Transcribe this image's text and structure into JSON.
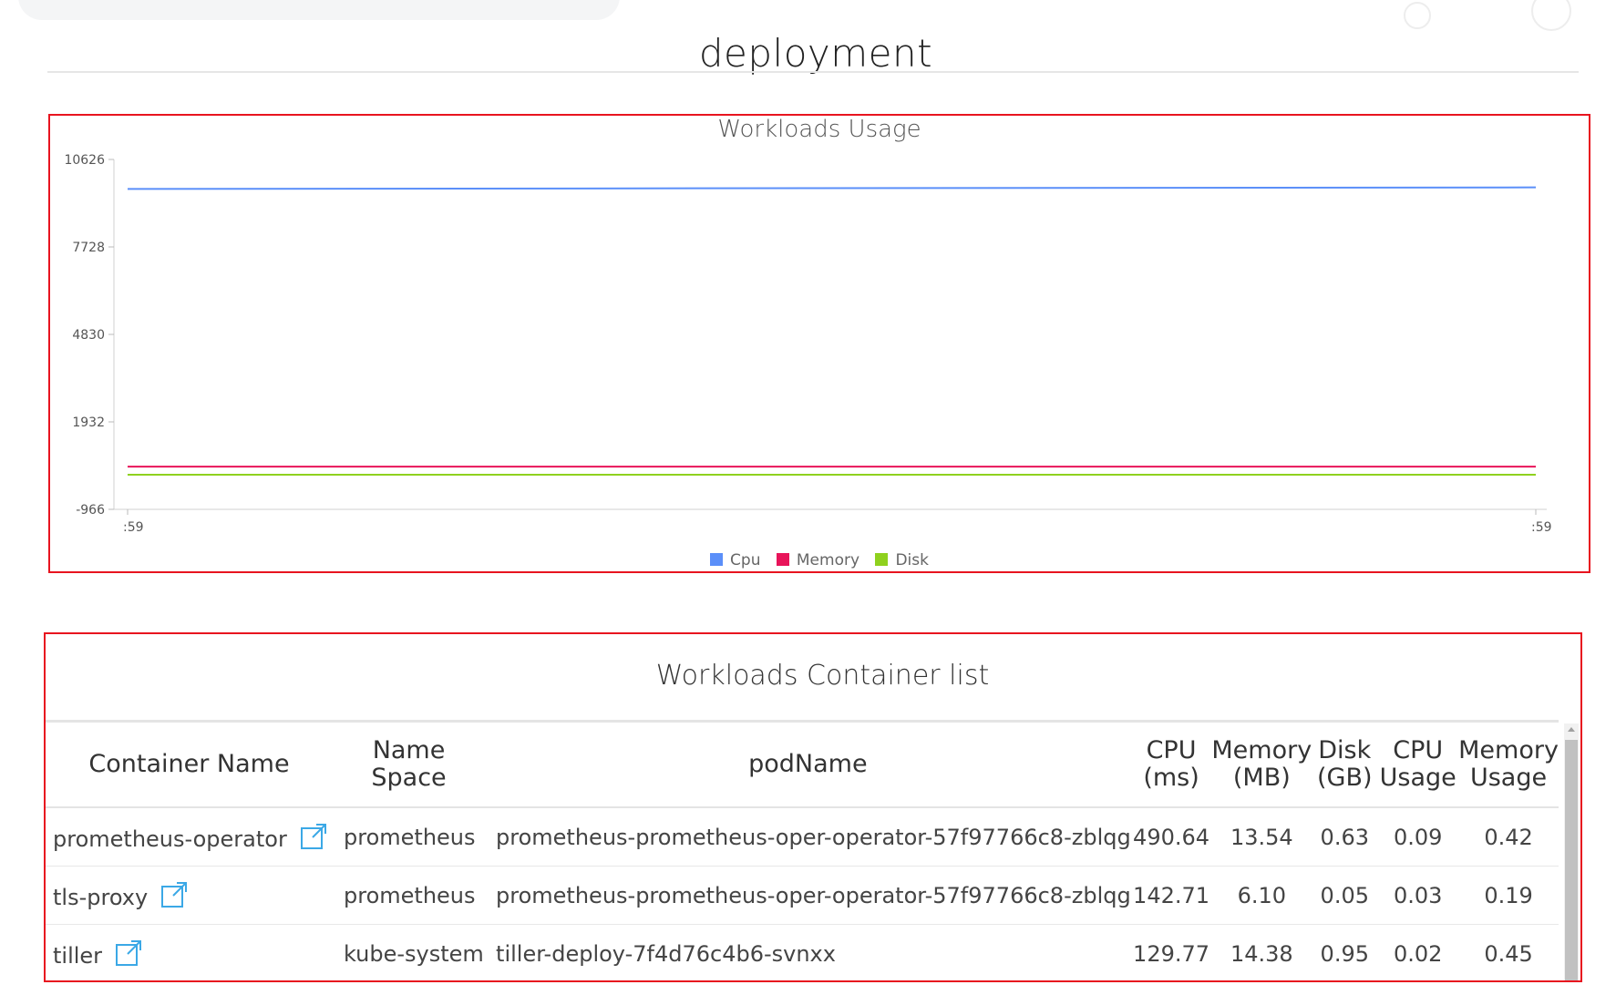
{
  "page": {
    "title": "deployment"
  },
  "chart_panel": {
    "title": "Workloads Usage"
  },
  "chart_data": {
    "type": "line",
    "title": "Workloads Usage",
    "x": [
      ":59",
      ":59"
    ],
    "y_ticks": [
      10626,
      7728,
      4830,
      1932,
      -966
    ],
    "ylim": [
      -966,
      10626
    ],
    "grid": false,
    "legend": "bottom",
    "series": [
      {
        "name": "Cpu",
        "color": "#5b8ff9",
        "values": [
          9649,
          9700
        ]
      },
      {
        "name": "Memory",
        "color": "#e8145a",
        "values": [
          449,
          449
        ]
      },
      {
        "name": "Disk",
        "color": "#8fd11e",
        "values": [
          183,
          183
        ]
      }
    ]
  },
  "table_panel": {
    "title": "Workloads Container list",
    "headers": {
      "name": "Container Name",
      "ns": "Name Space",
      "pod": "podName",
      "cpu_1": "CPU",
      "cpu_2": "(ms)",
      "mem_1": "Memory",
      "mem_2": "(MB)",
      "disk_1": "Disk",
      "disk_2": "(GB)",
      "cpuu_1": "CPU",
      "cpuu_2": "Usage",
      "memu_1": "Memory",
      "memu_2": "Usage"
    },
    "rows": [
      {
        "name": "prometheus-operator",
        "ns": "prometheus",
        "pod": "prometheus-prometheus-oper-operator-57f97766c8-zblqg",
        "cpu": "490.64",
        "mem": "13.54",
        "disk": "0.63",
        "cpu_usage": "0.09",
        "mem_usage": "0.42"
      },
      {
        "name": "tls-proxy",
        "ns": "prometheus",
        "pod": "prometheus-prometheus-oper-operator-57f97766c8-zblqg",
        "cpu": "142.71",
        "mem": "6.10",
        "disk": "0.05",
        "cpu_usage": "0.03",
        "mem_usage": "0.19"
      },
      {
        "name": "tiller",
        "ns": "kube-system",
        "pod": "tiller-deploy-7f4d76c4b6-svnxx",
        "cpu": "129.77",
        "mem": "14.38",
        "disk": "0.95",
        "cpu_usage": "0.02",
        "mem_usage": "0.45"
      }
    ]
  },
  "colors": {
    "highlight_border": "#e8141f",
    "link_icon": "#3ba8e6"
  },
  "icons": {
    "external_link": "external-link-icon"
  }
}
